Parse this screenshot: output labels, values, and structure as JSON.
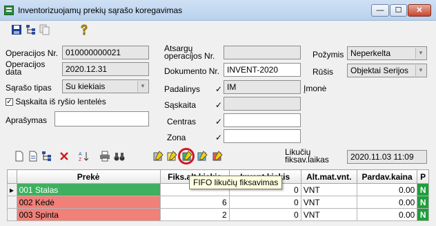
{
  "window": {
    "title": "Inventorizuojamų prekių sąrašo koregavimas",
    "minimize_glyph": "—",
    "maximize_glyph": "☐",
    "close_glyph": "✕"
  },
  "toolbar_top": {
    "icons": [
      "save-icon",
      "tree-add-icon",
      "copy-icon",
      "help-icon"
    ]
  },
  "form": {
    "operacijos_nr": {
      "label": "Operacijos Nr.",
      "value": "010000000021"
    },
    "operacijos_data": {
      "label": "Operacijos data",
      "value": "2020.12.31"
    },
    "saraso_tipas": {
      "label": "Sąrašo tipas",
      "value": "Su kiekiais"
    },
    "saskaita_is_rysio": {
      "label": "Sąskaita iš ryšio lentelės",
      "checked": true,
      "check_glyph": "✓"
    },
    "aprasymas": {
      "label": "Aprašymas",
      "value": ""
    },
    "atsargu_operacijos_nr": {
      "label": "Atsargų operacijos Nr.",
      "value": ""
    },
    "dokumento_nr": {
      "label": "Dokumento Nr.",
      "value": "INVENT-2020"
    },
    "padalinys": {
      "label": "Padalinys",
      "value": "IM",
      "extra": "Įmonė"
    },
    "saskaita": {
      "label": "Sąskaita",
      "value": ""
    },
    "centras": {
      "label": "Centras",
      "value": ""
    },
    "zona": {
      "label": "Zona",
      "value": ""
    },
    "pozymis": {
      "label": "Požymis",
      "value": "Neperkelta"
    },
    "rusis": {
      "label": "Rūšis",
      "value": "Objektai Serijos"
    },
    "check_glyph": "✓",
    "dropdown_glyph": "▼"
  },
  "toolbar_grid": {
    "likuciu_label": "Likučių fiksav.laikas",
    "likuciu_value": "2020.11.03 11:09",
    "icons": [
      "new-doc-icon",
      "edit-doc-icon",
      "tree-add-icon",
      "delete-icon",
      "sort-az-icon",
      "print-icon",
      "binoculars-icon",
      "fifo-gray-icon",
      "fifo-yellow-icon",
      "fifo-green-icon",
      "fifo-cyan-icon",
      "fifo-red-icon"
    ]
  },
  "tooltip": "FIFO likučių fiksavimas",
  "grid": {
    "columns": [
      "Prekė",
      "Fiks.alt.kiekis",
      "Invent.kiekis",
      "Alt.mat.vnt.",
      "Pardav.kaina",
      "P"
    ],
    "rows": [
      {
        "preke": "001  Stalas",
        "fiks": "",
        "invent": "0",
        "vnt": "VNT",
        "kaina": "0.00",
        "p": "N"
      },
      {
        "preke": "002  Kėdė",
        "fiks": "6",
        "invent": "0",
        "vnt": "VNT",
        "kaina": "0.00",
        "p": "N"
      },
      {
        "preke": "003  Spinta",
        "fiks": "2",
        "invent": "0",
        "vnt": "VNT",
        "kaina": "0.00",
        "p": "N"
      }
    ],
    "row_indicator": "▸"
  }
}
